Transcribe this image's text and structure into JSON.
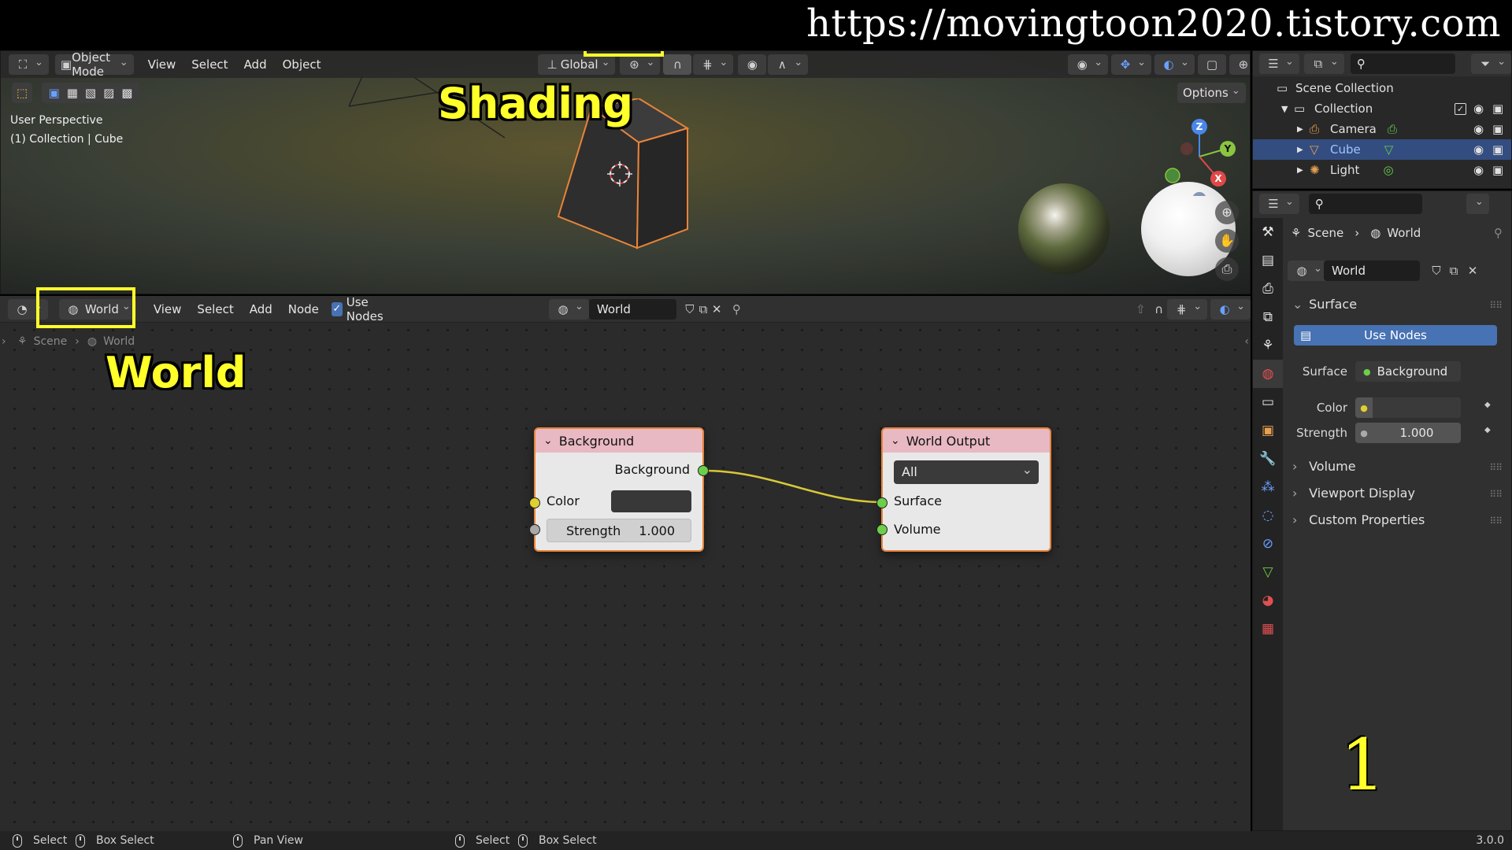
{
  "watermark_url": "https://movingtoon2020.tistory.com",
  "captions": {
    "shading": "Shading",
    "world": "World",
    "step": "1"
  },
  "viewport": {
    "mode_label": "Object Mode",
    "menus": [
      "View",
      "Select",
      "Add",
      "Object"
    ],
    "transform_orientation": "Global",
    "options_label": "Options",
    "overlay_line1": "User Perspective",
    "overlay_line2": "(1) Collection | Cube",
    "axis": {
      "z": "Z",
      "y": "Y",
      "x": "X"
    }
  },
  "node_editor": {
    "shader_type": "World",
    "menus": [
      "View",
      "Select",
      "Add",
      "Node"
    ],
    "use_nodes_label": "Use Nodes",
    "datablock_name": "World",
    "breadcrumb": {
      "scene": "Scene",
      "world": "World"
    },
    "background_node": {
      "title": "Background",
      "output_label": "Background",
      "color_label": "Color",
      "strength_label": "Strength",
      "strength_value": "1.000"
    },
    "output_node": {
      "title": "World Output",
      "target": "All",
      "surface_label": "Surface",
      "volume_label": "Volume"
    }
  },
  "outliner": {
    "root": "Scene Collection",
    "collection": "Collection",
    "items": [
      "Camera",
      "Cube",
      "Light"
    ]
  },
  "properties": {
    "breadcrumb": {
      "scene": "Scene",
      "world": "World"
    },
    "world_name": "World",
    "surface_section": "Surface",
    "use_nodes_button": "Use Nodes",
    "surface_label": "Surface",
    "surface_value": "Background",
    "color_label": "Color",
    "strength_label": "Strength",
    "strength_value": "1.000",
    "sections": [
      "Volume",
      "Viewport Display",
      "Custom Properties"
    ]
  },
  "statusbar": {
    "items": [
      "Select",
      "Box Select",
      "Pan View",
      "Select",
      "Box Select"
    ],
    "version": "3.0.0"
  },
  "colors": {
    "accent_orange": "#e8843a",
    "node_header": "#e8b8c3",
    "socket_green": "#6ccf4a",
    "socket_yellow": "#e0cf30",
    "use_nodes_blue": "#4772b3"
  }
}
